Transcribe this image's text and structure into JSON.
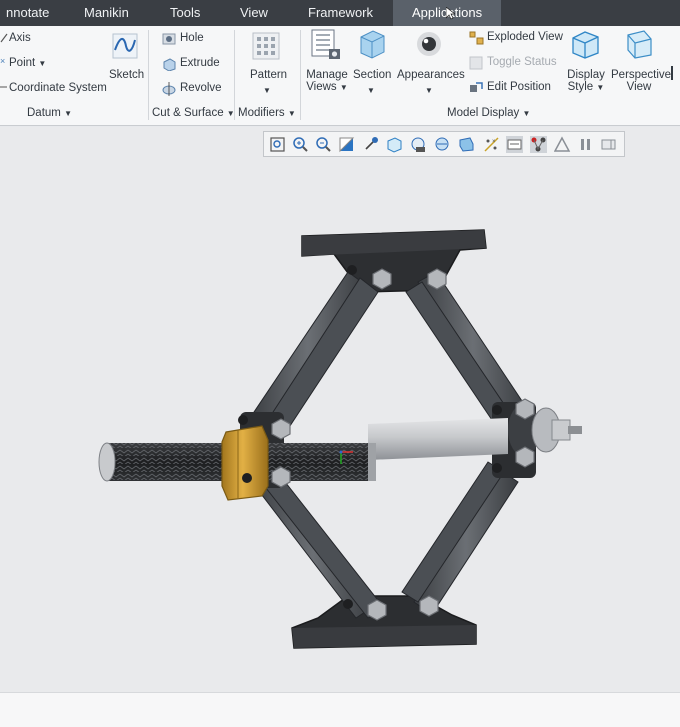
{
  "tabs": [
    {
      "label": "nnotate"
    },
    {
      "label": "Manikin"
    },
    {
      "label": "Tools"
    },
    {
      "label": "View"
    },
    {
      "label": "Framework"
    },
    {
      "label": "Applications",
      "active": true
    }
  ],
  "ribbon": {
    "datum": {
      "items": [
        "Axis",
        "Point",
        "Coordinate System"
      ],
      "sketch": "Sketch",
      "group_label": "Datum"
    },
    "cut_surface": {
      "items": [
        "Hole",
        "Extrude",
        "Revolve"
      ],
      "group_label": "Cut & Surface"
    },
    "modifiers": {
      "pattern": "Pattern",
      "group_label": "Modifiers"
    },
    "model_display": {
      "manage_views": [
        "Manage",
        "Views"
      ],
      "section": "Section",
      "appearances": "Appearances",
      "exploded_view": "Exploded View",
      "toggle_status": "Toggle Status",
      "edit_position": "Edit Position",
      "display_style": [
        "Display",
        "Style"
      ],
      "perspective_view": [
        "Perspective",
        "View"
      ],
      "group_label": "Model Display"
    }
  },
  "graphics_toolbar": {
    "icons": [
      "refit-icon",
      "zoom-in-icon",
      "zoom-out-icon",
      "repaint-icon",
      "spin-center-icon",
      "display-style-icon",
      "saved-orientations-icon",
      "view-manager-icon",
      "perspective-icon",
      "datum-display-icon",
      "annotation-display-icon",
      "section-icon",
      "simplify-icon",
      "pause-icon",
      "close-panel-icon"
    ]
  },
  "colors": {
    "tabbar": "#3a3e44",
    "active_tab": "#5a616a",
    "ribbon": "#f6f7f8",
    "canvas": "#e9eaec",
    "steel": "#5d6166",
    "dark_part": "#2b2d30",
    "brass_nut": "#c9972e"
  }
}
